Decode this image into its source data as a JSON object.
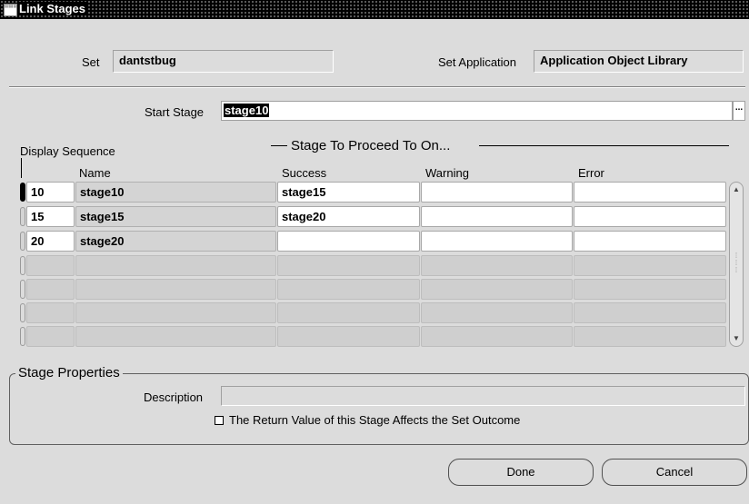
{
  "window": {
    "title": "Link Stages"
  },
  "header": {
    "set_label": "Set",
    "set_value": "dantstbug",
    "set_application_label": "Set Application",
    "set_application_value": "Application Object Library"
  },
  "start_stage": {
    "label": "Start Stage",
    "value": "stage10",
    "lov_button": "..."
  },
  "grid": {
    "display_sequence_label": "Display Sequence",
    "group_label": "Stage To Proceed To On...",
    "columns": {
      "name": "Name",
      "success": "Success",
      "warning": "Warning",
      "error": "Error"
    },
    "rows": [
      {
        "seq": "10",
        "name": "stage10",
        "success": "stage15",
        "warning": "",
        "error": ""
      },
      {
        "seq": "15",
        "name": "stage15",
        "success": "stage20",
        "warning": "",
        "error": ""
      },
      {
        "seq": "20",
        "name": "stage20",
        "success": "",
        "warning": "",
        "error": ""
      }
    ]
  },
  "properties": {
    "group_label": "Stage Properties",
    "description_label": "Description",
    "description_value": "",
    "checkbox_label": "The Return Value of this Stage Affects the Set Outcome",
    "checkbox_checked": false
  },
  "buttons": {
    "done": "Done",
    "cancel": "Cancel"
  },
  "colors": {
    "titlebar": "#000000",
    "background": "#dcdcdc",
    "field_white": "#ffffff"
  }
}
